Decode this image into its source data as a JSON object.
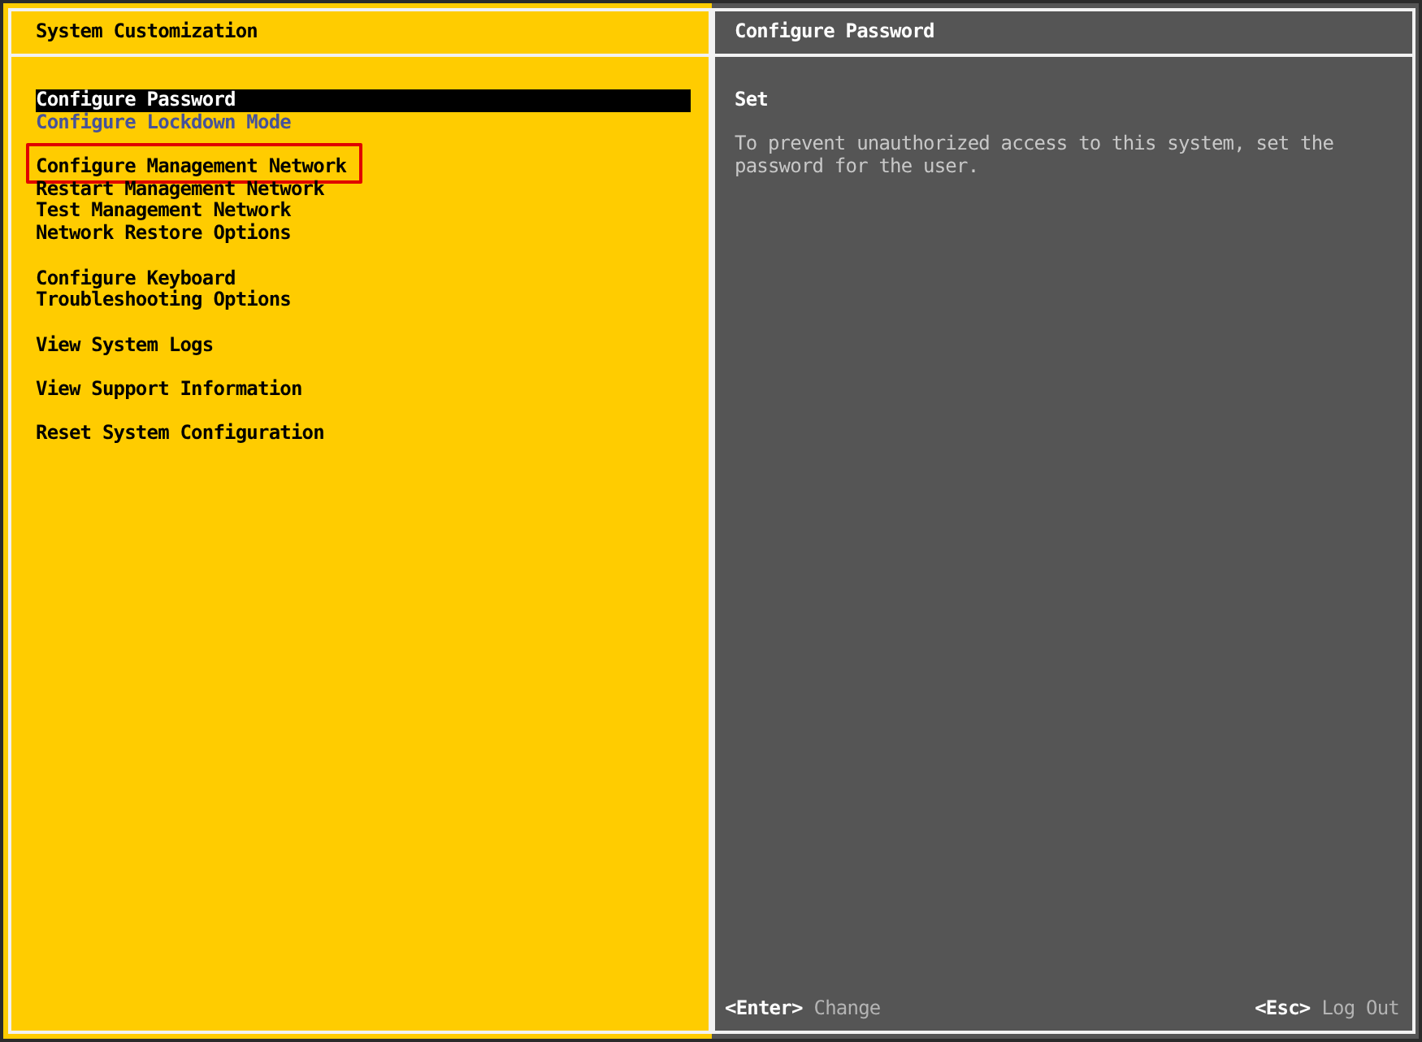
{
  "left_panel": {
    "title": "System Customization",
    "menu_groups": [
      {
        "items": [
          {
            "label": "Configure Password",
            "selected": true,
            "disabled": false,
            "outlined": false
          },
          {
            "label": "Configure Lockdown Mode",
            "selected": false,
            "disabled": true,
            "outlined": false
          }
        ]
      },
      {
        "items": [
          {
            "label": "Configure Management Network",
            "selected": false,
            "disabled": false,
            "outlined": true
          },
          {
            "label": "Restart Management Network",
            "selected": false,
            "disabled": false,
            "outlined": false
          },
          {
            "label": "Test Management Network",
            "selected": false,
            "disabled": false,
            "outlined": false
          },
          {
            "label": "Network Restore Options",
            "selected": false,
            "disabled": false,
            "outlined": false
          }
        ]
      },
      {
        "items": [
          {
            "label": "Configure Keyboard",
            "selected": false,
            "disabled": false,
            "outlined": false
          },
          {
            "label": "Troubleshooting Options",
            "selected": false,
            "disabled": false,
            "outlined": false
          }
        ]
      },
      {
        "items": [
          {
            "label": "View System Logs",
            "selected": false,
            "disabled": false,
            "outlined": false
          }
        ]
      },
      {
        "items": [
          {
            "label": "View Support Information",
            "selected": false,
            "disabled": false,
            "outlined": false
          }
        ]
      },
      {
        "items": [
          {
            "label": "Reset System Configuration",
            "selected": false,
            "disabled": false,
            "outlined": false
          }
        ]
      }
    ]
  },
  "right_panel": {
    "title": "Configure Password",
    "heading": "Set",
    "description": "To prevent unauthorized access to this system, set the password for the user."
  },
  "footer_hints": [
    {
      "key": "<Enter>",
      "action": "Change"
    },
    {
      "key": "<Esc>",
      "action": "Log Out"
    }
  ]
}
